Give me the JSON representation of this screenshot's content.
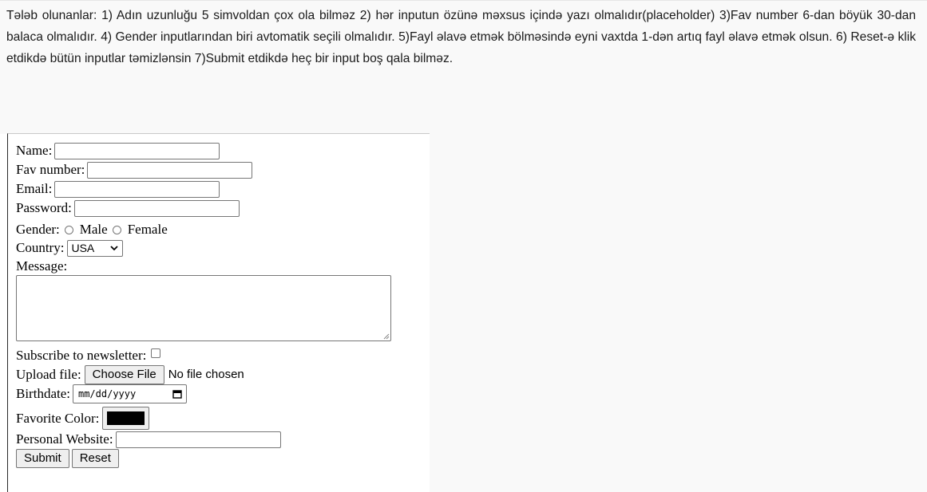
{
  "requirements_text": "Tələb olunanlar: 1) Adın uzunluğu 5 simvoldan çox ola bilməz 2) hər inputun özünə məxsus içində yazı olmalıdır(placeholder) 3)Fav number 6-dan böyük 30-dan balaca olmalıdır. 4) Gender inputlarından biri avtomatik seçili olmalıdır. 5)Fayl əlavə etmək bölməsində eyni vaxtda 1-dən artıq fayl əlavə etmək olsun. 6) Reset-ə klik etdikdə bütün inputlar təmizlənsin 7)Submit etdikdə heç bir input boş qala bilməz.",
  "form": {
    "name_label": "Name:",
    "name_value": "",
    "fav_number_label": "Fav number:",
    "fav_number_value": "",
    "email_label": "Email:",
    "email_value": "",
    "password_label": "Password:",
    "password_value": "",
    "gender_label": "Gender:",
    "gender_options": [
      "Male",
      "Female"
    ],
    "country_label": "Country:",
    "country_selected": "USA",
    "message_label": "Message:",
    "message_value": "",
    "newsletter_label": "Subscribe to newsletter:",
    "upload_label": "Upload file:",
    "choose_file_label": "Choose File",
    "no_file_text": "No file chosen",
    "birthdate_label": "Birthdate:",
    "birthdate_placeholder": "mm/dd/yyyy",
    "favorite_color_label": "Favorite Color:",
    "favorite_color_value": "#000000",
    "website_label": "Personal Website:",
    "website_value": "",
    "submit_label": "Submit",
    "reset_label": "Reset"
  },
  "colors": {
    "page_background": "#f9f9f9",
    "frame_background": "#ffffff",
    "input_border": "#767676",
    "button_background": "#efefef"
  }
}
